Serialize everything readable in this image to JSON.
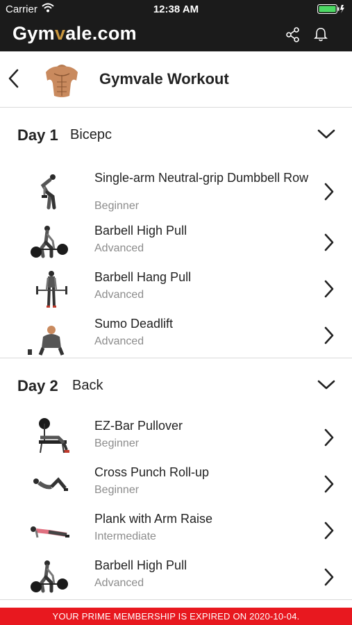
{
  "status": {
    "carrier": "Carrier",
    "time": "12:38 AM"
  },
  "app": {
    "brand_left": "Gym",
    "brand_accent": "v",
    "brand_right": "ale.com"
  },
  "header": {
    "title": "Gymvale Workout"
  },
  "days": [
    {
      "num": "Day 1",
      "name": "Bicepc",
      "exercises": [
        {
          "title": "Single-arm Neutral-grip Dumbbell Row",
          "level": "Beginner"
        },
        {
          "title": "Barbell High Pull",
          "level": "Advanced"
        },
        {
          "title": "Barbell Hang Pull",
          "level": "Advanced"
        },
        {
          "title": "Sumo Deadlift",
          "level": "Advanced"
        }
      ]
    },
    {
      "num": "Day 2",
      "name": "Back",
      "exercises": [
        {
          "title": "EZ-Bar Pullover",
          "level": "Beginner"
        },
        {
          "title": "Cross Punch Roll-up",
          "level": "Beginner"
        },
        {
          "title": "Plank with Arm Raise",
          "level": "Intermediate"
        },
        {
          "title": "Barbell High Pull",
          "level": "Advanced"
        }
      ]
    }
  ],
  "banner": {
    "text": "YOUR PRIME MEMBERSHIP IS EXPIRED ON 2020-10-04."
  },
  "colors": {
    "appbar": "#1b1b1b",
    "accent": "#c8963e",
    "banner": "#e8181f",
    "battery": "#4cd964"
  }
}
